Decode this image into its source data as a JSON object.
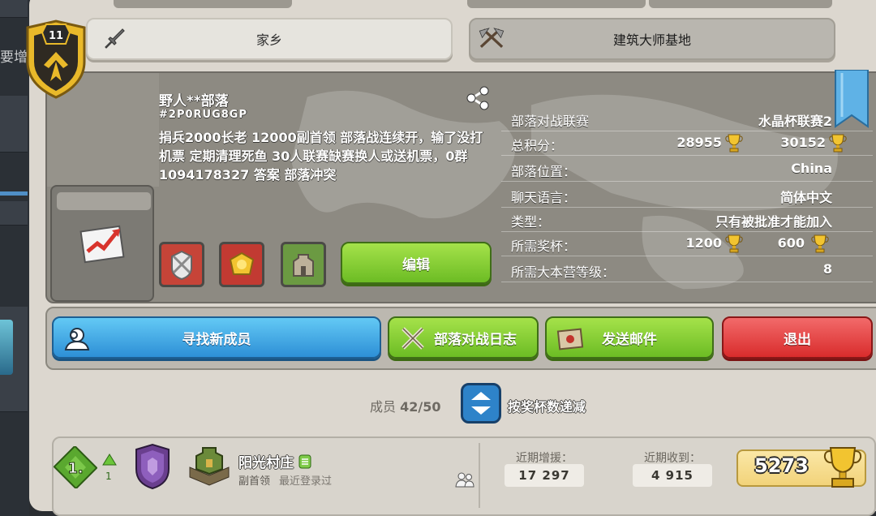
{
  "left_strip": {
    "partial_label": "要增"
  },
  "tabs": {
    "home": {
      "label": "家乡",
      "icon": "sword-icon"
    },
    "builder": {
      "label": "建筑大师基地",
      "icon": "crossed-axes-icon"
    }
  },
  "clan": {
    "level": "11",
    "name": "野人**部落",
    "tag": "#2P0RUG8GP",
    "description": "捐兵2000长老 12000副首领 部落战连续开，输了没打机票 定期清理死鱼 30人联赛缺赛换人或送机票，0群1094178327 答案 部落冲突",
    "edit_label": "编辑"
  },
  "stats": {
    "war_league": {
      "label": "部落对战联赛",
      "value": "水晶杯联赛2"
    },
    "total_points": {
      "label": "总积分：",
      "home": "28955",
      "builder": "30152"
    },
    "location": {
      "label": "部落位置：",
      "value": "China"
    },
    "chat_language": {
      "label": "聊天语言：",
      "value": "简体中文"
    },
    "type": {
      "label": "类型：",
      "value": "只有被批准才能加入"
    },
    "required_trophies": {
      "label": "所需奖杯：",
      "home": "1200",
      "builder": "600"
    },
    "required_th": {
      "label": "所需大本营等级：",
      "value": "8"
    }
  },
  "actions": {
    "find_members": "寻找新成员",
    "war_log": "部落对战日志",
    "send_mail": "发送邮件",
    "leave": "退出"
  },
  "members": {
    "count_label": "成员",
    "count": "42/50",
    "sort_label": "按奖杯数递减"
  },
  "member_row": {
    "rank": "1.",
    "rank_change": "1",
    "name": "阳光村庄",
    "role": "副首领",
    "last_seen": "最近登录过",
    "donated_label": "近期增援：",
    "donated_value": "17 297",
    "received_label": "近期收到：",
    "received_value": "4 915",
    "trophies": "5273"
  },
  "colors": {
    "green_button": "#6cbc24",
    "blue_button": "#2d8fd6",
    "red_button": "#d92c2c",
    "panel": "#dcd7cf",
    "info_bg": "#8d8a82"
  }
}
